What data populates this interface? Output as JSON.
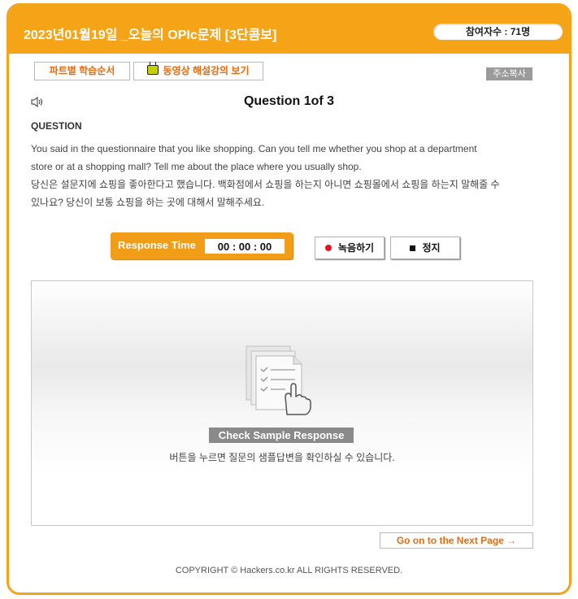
{
  "header": {
    "title": "2023년01월19일 _오늘의 OPIc문제 [3단콤보]",
    "participants": "참여자수 : 71명"
  },
  "toolbar": {
    "study_order_label": "파트별 학습순서",
    "video_lecture_label": "동영상 해설강의 보기",
    "copy_address_label": "주소복사"
  },
  "question": {
    "counter": "Question 1of 3",
    "label": "QUESTION",
    "text_en_1": "You said in the questionnaire that you like shopping. Can you tell me whether you shop at a department",
    "text_en_2": "store or at a shopping mall? Tell me about the place where you usually shop.",
    "text_ko_1": "당신은 설문지에 쇼핑을 좋아한다고 했습니다. 백화점에서 쇼핑을 하는지 아니면 쇼핑몰에서 쇼핑을 하는지 말해줄 수",
    "text_ko_2": "있나요? 당신이 보통 쇼핑을 하는 곳에 대해서 말해주세요."
  },
  "recorder": {
    "response_label": "Response Time",
    "time": "00 : 00 : 00",
    "record_label": "녹음하기",
    "stop_label": "정지",
    "record_color": "#e8141e"
  },
  "sample": {
    "button_label": "Check Sample Response",
    "hint": "버튼을 누르면 질문의 샘플답변을 확인하실 수 있습니다.",
    "icon": "document-hand-cursor-icon"
  },
  "footer": {
    "next_label": "Go on to the Next Page →",
    "copyright": "COPYRIGHT © Hackers.co.kr ALL RIGHTS RESERVED."
  },
  "colors": {
    "accent": "#f5a418",
    "link": "#ea6a0a"
  }
}
